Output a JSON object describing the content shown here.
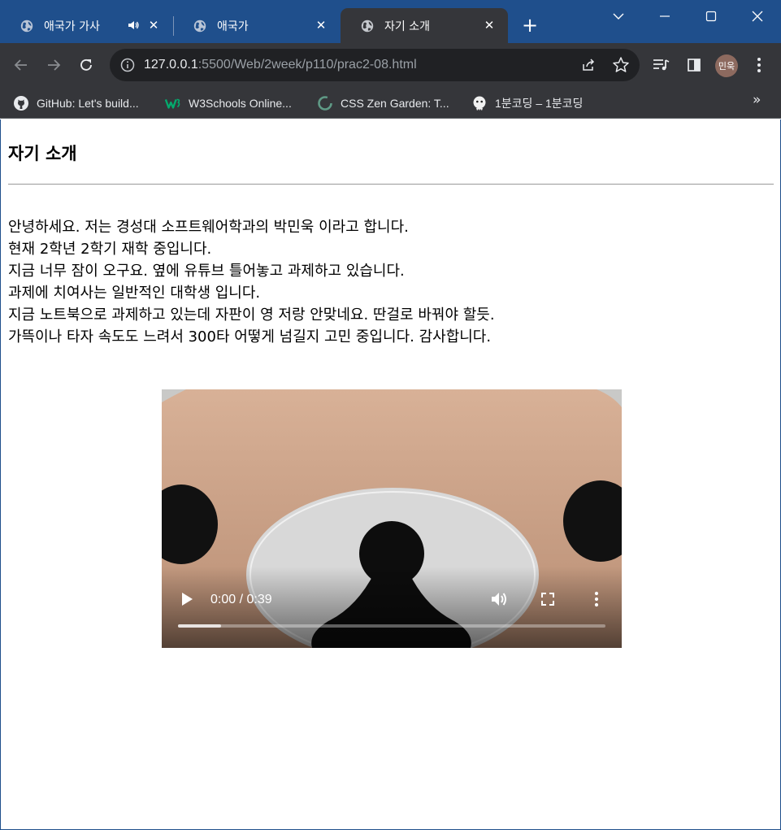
{
  "tabs": [
    {
      "title": "애국가 가사",
      "audio": true
    },
    {
      "title": "애국가"
    },
    {
      "title": "자기 소개",
      "active": true
    }
  ],
  "address": {
    "host": "127.0.0.1",
    "path": ":5500/Web/2week/p110/prac2-08.html"
  },
  "profile": {
    "initials": "민욱"
  },
  "bookmarks": [
    {
      "label": "GitHub: Let's build...",
      "icon": "github-icon"
    },
    {
      "label": "W3Schools Online...",
      "icon": "w3schools-icon"
    },
    {
      "label": "CSS Zen Garden: T...",
      "icon": "zen-garden-icon"
    },
    {
      "label": "1분코딩 – 1분코딩",
      "icon": "1bun-coding-icon"
    }
  ],
  "page": {
    "heading": "자기 소개",
    "lines": [
      "안녕하세요. 저는 경성대 소프트웨어학과의 박민욱 이라고 합니다.",
      "현재 2학년 2학기 재학 중입니다.",
      "지금 너무 잠이 오구요. 옆에 유튜브 틀어놓고 과제하고 있습니다.",
      "과제에 치여사는 일반적인 대학생 입니다.",
      "지금 노트북으로 과제하고 있는데 자판이 영 저랑 안맞네요. 딴걸로 바꿔야 할듯.",
      "가뜩이나 타자 속도도 느려서 300타 어떻게 넘길지 고민 중입니다. 감사합니다."
    ]
  },
  "video": {
    "time": "0:00 / 0:39",
    "buffered_fraction": 0.1
  },
  "colors": {
    "titlebar": "#1f4f8c",
    "active_tab": "#35363a",
    "toolbar": "#35363a",
    "omnibox": "#202124"
  }
}
